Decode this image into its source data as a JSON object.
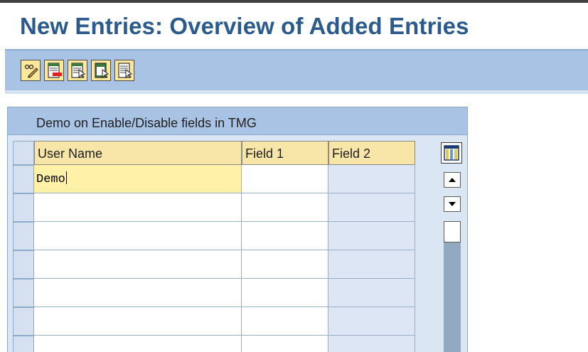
{
  "page": {
    "title": "New Entries: Overview of Added Entries"
  },
  "toolbar": {
    "buttons": [
      {
        "name": "change-display-button",
        "icon": "pencil-glasses-icon"
      },
      {
        "name": "delete-button",
        "icon": "delete-row-icon"
      },
      {
        "name": "select-all-button",
        "icon": "select-all-icon"
      },
      {
        "name": "select-block-button",
        "icon": "select-block-icon"
      },
      {
        "name": "deselect-all-button",
        "icon": "deselect-all-icon"
      }
    ]
  },
  "table": {
    "title": "Demo on Enable/Disable fields in TMG",
    "columns": [
      "User Name",
      "Field 1",
      "Field 2"
    ],
    "rows": [
      [
        "Demo",
        "",
        ""
      ],
      [
        "",
        "",
        ""
      ],
      [
        "",
        "",
        ""
      ],
      [
        "",
        "",
        ""
      ],
      [
        "",
        "",
        ""
      ],
      [
        "",
        "",
        ""
      ],
      [
        "",
        "",
        ""
      ]
    ],
    "column_settings_icon": "column-settings-icon",
    "scroll_up_icon": "scroll-up-icon",
    "scroll_down_icon": "scroll-down-icon"
  },
  "colors": {
    "title": "#2b5a8c",
    "toolbar": "#a9c3e4",
    "header_cell": "#f7e6a8",
    "active_cell": "#fff2a8",
    "disabled_cell": "#dde6f4"
  }
}
